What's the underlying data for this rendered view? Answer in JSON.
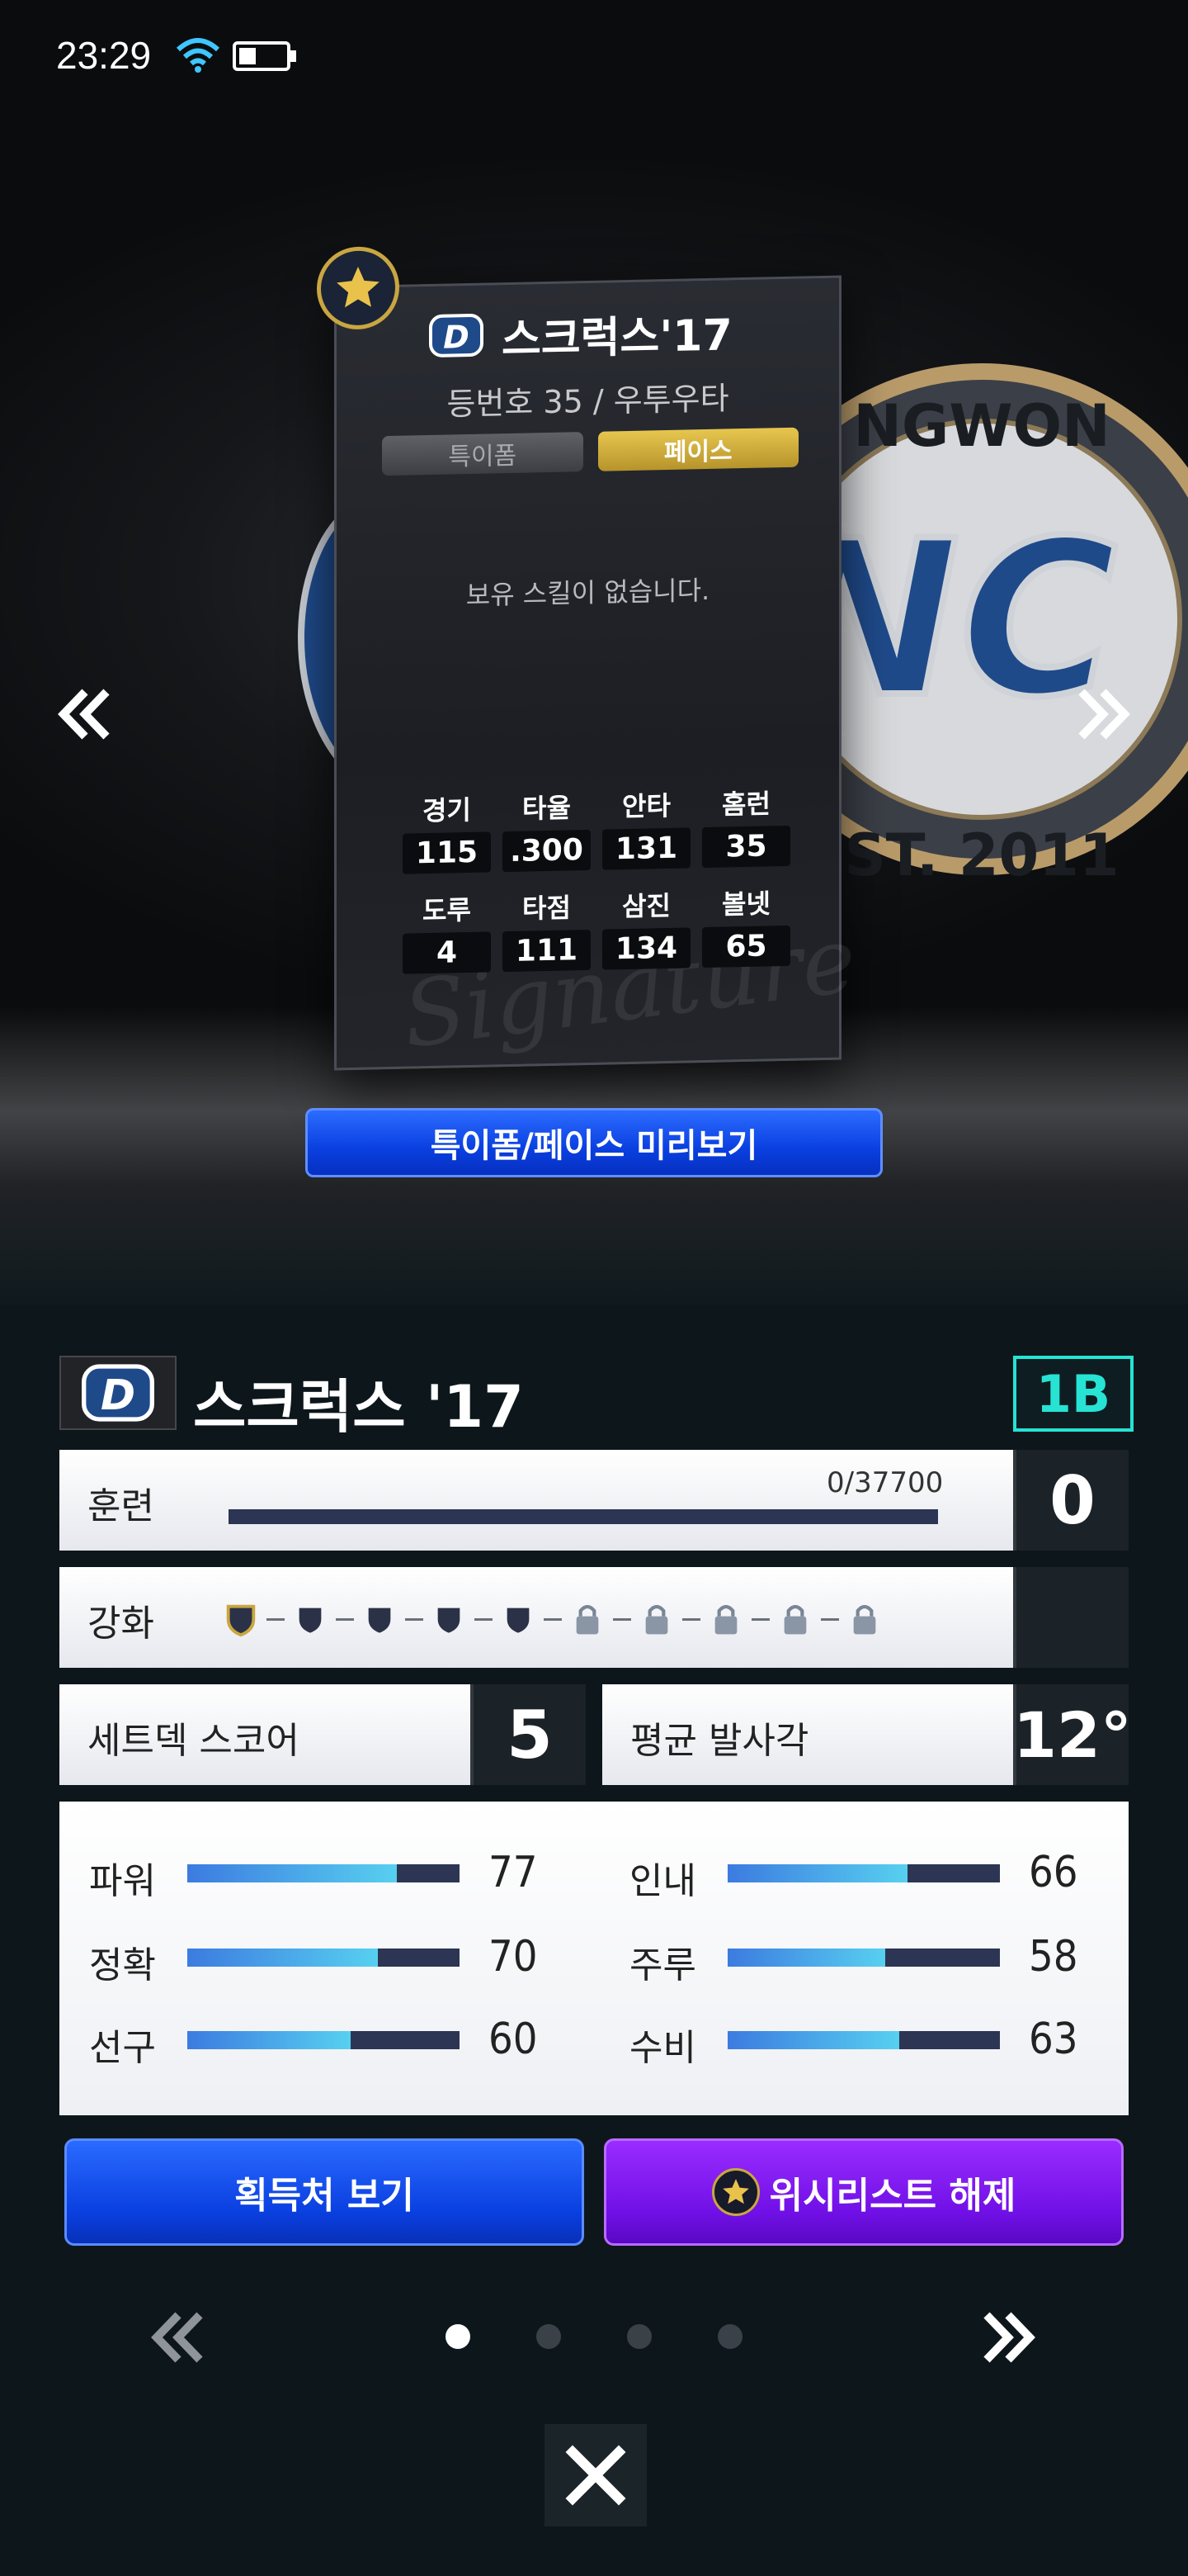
{
  "status_bar": {
    "time": "23:29"
  },
  "card": {
    "name": "스크럭스'17",
    "subtitle": "등번호 35 / 우투우타",
    "tabs": [
      {
        "label": "특이폼",
        "active": false
      },
      {
        "label": "페이스",
        "active": true
      }
    ],
    "no_skill_text": "보유 스킬이 없습니다.",
    "signature_text": "Signature",
    "stats": [
      {
        "label": "경기",
        "value": "115"
      },
      {
        "label": "타율",
        "value": ".300"
      },
      {
        "label": "안타",
        "value": "131"
      },
      {
        "label": "홈런",
        "value": "35"
      },
      {
        "label": "도루",
        "value": "4"
      },
      {
        "label": "타점",
        "value": "111"
      },
      {
        "label": "삼진",
        "value": "134"
      },
      {
        "label": "볼넷",
        "value": "65"
      }
    ]
  },
  "preview_button": "특이폼/페이스 미리보기",
  "player": {
    "name": "스크럭스 '17",
    "position": "1B"
  },
  "training": {
    "label": "훈련",
    "progress_text": "0/37700",
    "level": "0",
    "progress_fraction": 0.0
  },
  "enhance": {
    "label": "강화",
    "unlocked_count": 5,
    "total": 10
  },
  "setdeck": {
    "label": "세트덱 스코어",
    "value": "5"
  },
  "launch_angle": {
    "label": "평균 발사각",
    "value": "12°"
  },
  "abilities": [
    {
      "label": "파워",
      "value": "77"
    },
    {
      "label": "정확",
      "value": "70"
    },
    {
      "label": "선구",
      "value": "60"
    },
    {
      "label": "인내",
      "value": "66"
    },
    {
      "label": "주루",
      "value": "58"
    },
    {
      "label": "수비",
      "value": "63"
    }
  ],
  "buttons": {
    "acquire": "획득처 보기",
    "wishlist": "위시리스트 해제"
  },
  "pager": {
    "count": 4,
    "active": 0
  },
  "colors": {
    "accent_teal": "#26e3d4",
    "gold": "#c9a640",
    "blue_btn": "#0a3fe0",
    "purple_btn": "#7010e6"
  }
}
